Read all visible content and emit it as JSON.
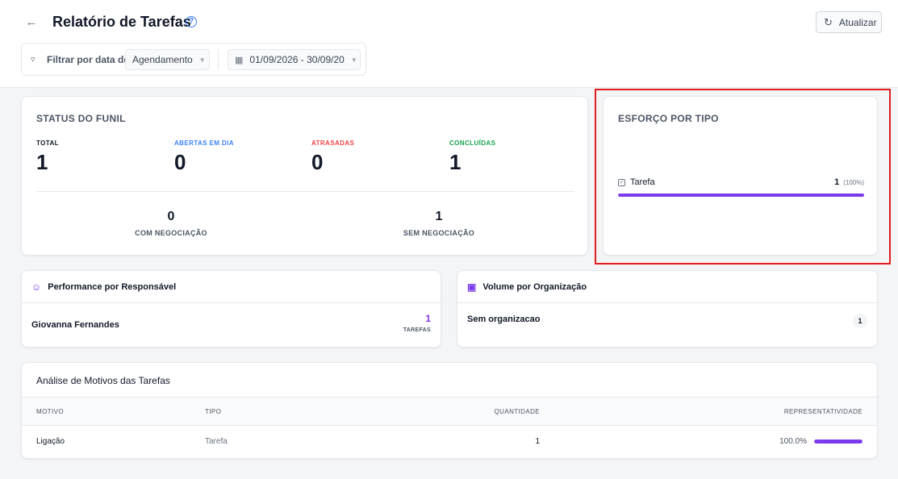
{
  "header": {
    "back_icon": "arrow-left-icon",
    "title": "Relatório de Tarefas",
    "help_glyph": "?",
    "refresh_label": "Atualizar"
  },
  "filters": {
    "label": "Filtrar por data de:",
    "date_type": "Agendamento",
    "date_range": "01/09/2026 - 30/09/20"
  },
  "funnel": {
    "title": "STATUS DO FUNIL",
    "stats": [
      {
        "label": "TOTAL",
        "value": "1",
        "color": "#111827"
      },
      {
        "label": "ABERTAS EM DIA",
        "value": "0",
        "color": "#3b82f6"
      },
      {
        "label": "ATRASADAS",
        "value": "0",
        "color": "#ef4444"
      },
      {
        "label": "CONCLUÍDAS",
        "value": "1",
        "color": "#16a34a"
      }
    ],
    "with_deal": {
      "value": "1",
      "label": "SEM NEGOCIAÇÃO"
    },
    "without_deal": {
      "value": "0",
      "label": "COM NEGOCIAÇÃO"
    }
  },
  "effort": {
    "title": "ESFORÇO POR TIPO",
    "items": [
      {
        "label": "Tarefa",
        "count": "1",
        "percent": "(100%)",
        "fraction": 1.0
      }
    ]
  },
  "performance": {
    "title": "Performance por Responsável",
    "rows": [
      {
        "name": "Giovanna Fernandes",
        "count": "1",
        "unit": "TAREFAS"
      }
    ]
  },
  "volume": {
    "title": "Volume por Organização",
    "rows": [
      {
        "name": "Sem organizacao",
        "count": "1"
      }
    ]
  },
  "reasons": {
    "title": "Análise de Motivos das Tarefas",
    "columns": [
      "MOTIVO",
      "TIPO",
      "QUANTIDADE",
      "REPRESENTATIVIDADE"
    ],
    "rows": [
      {
        "motivo": "Ligação",
        "tipo": "Tarefa",
        "quantidade": "1",
        "representatividade": "100.0%",
        "fraction": 1.0
      }
    ]
  },
  "colors": {
    "accent": "#7c3aed",
    "highlight": "#e11d1d"
  }
}
